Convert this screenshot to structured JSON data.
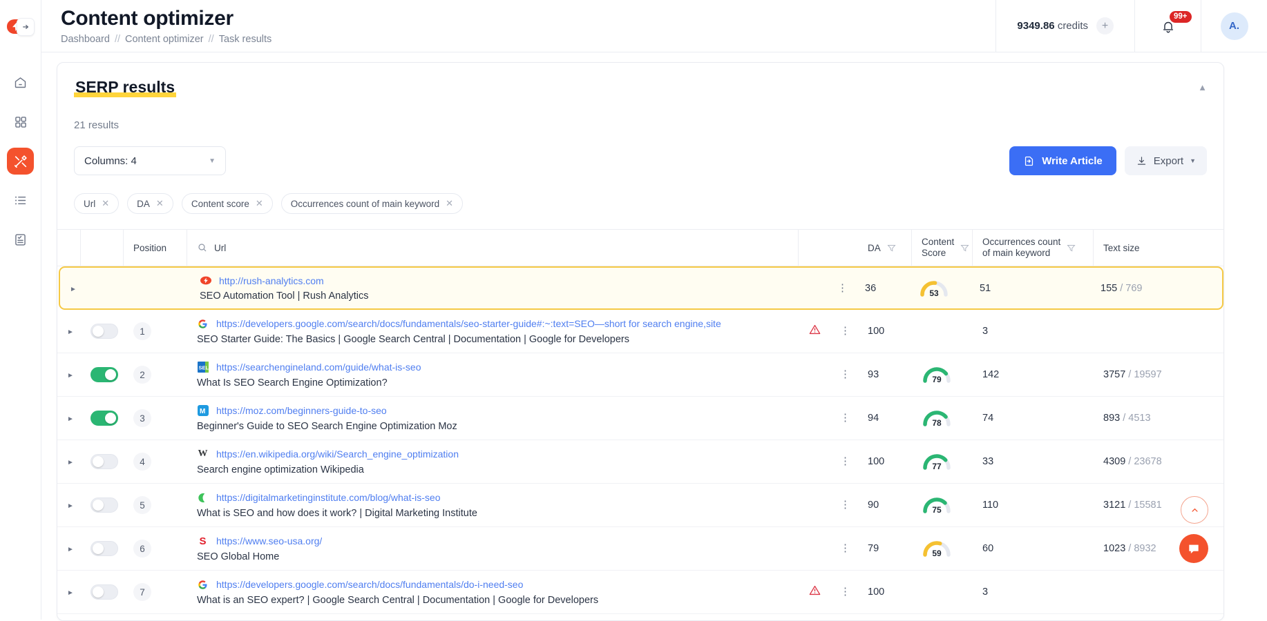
{
  "header": {
    "title": "Content optimizer",
    "breadcrumb": [
      "Dashboard",
      "Content optimizer",
      "Task results"
    ],
    "separator": "//",
    "credits_value": "9349.86",
    "credits_label": "credits",
    "add_credits_icon": "plus-icon",
    "notifications_badge": "99+",
    "notifications_icon": "bell-icon",
    "avatar_initials": "A.",
    "logo_icon": "lightning-bolt-logo",
    "sidebar_collapse_icon": "arrow-right-icon"
  },
  "sidebar": {
    "items": [
      {
        "name": "home",
        "icon": "home-icon",
        "active": false
      },
      {
        "name": "dashboard",
        "icon": "grid-icon",
        "active": false
      },
      {
        "name": "tools",
        "icon": "tools-icon",
        "active": true
      },
      {
        "name": "lists",
        "icon": "list-icon",
        "active": false
      },
      {
        "name": "reports",
        "icon": "document-check-icon",
        "active": false
      }
    ],
    "active_color": "#f4522d"
  },
  "card": {
    "title": "SERP results",
    "title_highlight_color": "#ffd43b",
    "collapse_icon": "chevron-up-icon",
    "results_count": "21 results",
    "columns_select": {
      "label": "Columns: 4",
      "caret_icon": "chevron-down-icon"
    },
    "buttons": {
      "write_article": {
        "label": "Write Article",
        "icon": "file-export-icon",
        "color": "#3b6ef5"
      },
      "export": {
        "label": "Export",
        "icon": "download-icon",
        "caret_icon": "caret-down-icon"
      }
    },
    "chips": [
      {
        "label": "Url",
        "remove_icon": "close-icon"
      },
      {
        "label": "DA",
        "remove_icon": "close-icon"
      },
      {
        "label": "Content score",
        "remove_icon": "close-icon"
      },
      {
        "label": "Occurrences count of main keyword",
        "remove_icon": "close-icon"
      }
    ]
  },
  "table": {
    "headers": {
      "position": "Position",
      "url": "Url",
      "url_search_icon": "search-icon",
      "da": "DA",
      "content_score_line1": "Content",
      "content_score_line2": "Score",
      "occurrences_line1": "Occurrences count",
      "occurrences_line2": "of main keyword",
      "text_size": "Text size",
      "filter_icon": "filter-icon"
    },
    "rows": [
      {
        "highlighted": true,
        "expand_icon": "caret-right-icon",
        "has_toggle": false,
        "position": "",
        "favicon": "rush-analytics-favicon",
        "favicon_char": "◆",
        "favicon_bg": "#f0452a",
        "url": "http://rush-analytics.com",
        "title": "SEO Automation Tool | Rush Analytics",
        "warning": false,
        "menu_icon": "kebab-menu-icon",
        "da": "36",
        "score": "53",
        "score_color": "#f5c131",
        "occurrences": "51",
        "text_size": "155",
        "text_total": "769"
      },
      {
        "highlighted": false,
        "expand_icon": "caret-right-icon",
        "has_toggle": true,
        "toggle_on": false,
        "position": "1",
        "favicon": "google-favicon",
        "favicon_char": "G",
        "favicon_color": "#4285f4",
        "url": "https://developers.google.com/search/docs/fundamentals/seo-starter-guide#:~:text=SEO—short for search engine,site",
        "title": "SEO Starter Guide: The Basics | Google Search Central | Documentation | Google for Developers",
        "warning": true,
        "warning_icon": "warning-triangle-icon",
        "menu_icon": "kebab-menu-icon",
        "da": "100",
        "score": "",
        "occurrences": "3",
        "text_size": "",
        "text_total": ""
      },
      {
        "highlighted": false,
        "expand_icon": "caret-right-icon",
        "has_toggle": true,
        "toggle_on": true,
        "position": "2",
        "favicon": "searchengineland-favicon",
        "favicon_char": "SEL",
        "favicon_bg": "#1a73c8",
        "url": "https://searchengineland.com/guide/what-is-seo",
        "title": "What Is SEO Search Engine Optimization?",
        "warning": false,
        "menu_icon": "kebab-menu-icon",
        "da": "93",
        "score": "79",
        "score_color": "#2bb673",
        "occurrences": "142",
        "text_size": "3757",
        "text_total": "19597"
      },
      {
        "highlighted": false,
        "expand_icon": "caret-right-icon",
        "has_toggle": true,
        "toggle_on": true,
        "position": "3",
        "favicon": "moz-favicon",
        "favicon_char": "M",
        "favicon_bg": "#1e9ae0",
        "url": "https://moz.com/beginners-guide-to-seo",
        "title": "Beginner's Guide to SEO Search Engine Optimization Moz",
        "warning": false,
        "menu_icon": "kebab-menu-icon",
        "da": "94",
        "score": "78",
        "score_color": "#2bb673",
        "occurrences": "74",
        "text_size": "893",
        "text_total": "4513"
      },
      {
        "highlighted": false,
        "expand_icon": "caret-right-icon",
        "has_toggle": true,
        "toggle_on": false,
        "position": "4",
        "favicon": "wikipedia-favicon",
        "favicon_char": "W",
        "favicon_color": "#36393b",
        "url": "https://en.wikipedia.org/wiki/Search_engine_optimization",
        "title": "Search engine optimization Wikipedia",
        "warning": false,
        "menu_icon": "kebab-menu-icon",
        "da": "100",
        "score": "77",
        "score_color": "#2bb673",
        "occurrences": "33",
        "text_size": "4309",
        "text_total": "23678"
      },
      {
        "highlighted": false,
        "expand_icon": "caret-right-icon",
        "has_toggle": true,
        "toggle_on": false,
        "position": "5",
        "favicon": "digitalmarketinginstitute-favicon",
        "favicon_char": "☾",
        "favicon_color": "#3ec35a",
        "url": "https://digitalmarketinginstitute.com/blog/what-is-seo",
        "title": "What is SEO and how does it work? | Digital Marketing Institute",
        "warning": false,
        "menu_icon": "kebab-menu-icon",
        "da": "90",
        "score": "75",
        "score_color": "#2bb673",
        "occurrences": "110",
        "text_size": "3121",
        "text_total": "15581"
      },
      {
        "highlighted": false,
        "expand_icon": "caret-right-icon",
        "has_toggle": true,
        "toggle_on": false,
        "position": "6",
        "favicon": "seo-usa-favicon",
        "favicon_char": "S",
        "favicon_color": "#e1202c",
        "url": "https://www.seo-usa.org/",
        "title": "SEO Global Home",
        "warning": false,
        "menu_icon": "kebab-menu-icon",
        "da": "79",
        "score": "59",
        "score_color": "#f5c131",
        "occurrences": "60",
        "text_size": "1023",
        "text_total": "8932"
      },
      {
        "highlighted": false,
        "expand_icon": "caret-right-icon",
        "has_toggle": true,
        "toggle_on": false,
        "position": "7",
        "favicon": "google-favicon",
        "favicon_char": "G",
        "favicon_color": "#4285f4",
        "url": "https://developers.google.com/search/docs/fundamentals/do-i-need-seo",
        "title": "What is an SEO expert? | Google Search Central | Documentation | Google for Developers",
        "warning": true,
        "warning_icon": "warning-triangle-icon",
        "menu_icon": "kebab-menu-icon",
        "da": "100",
        "score": "",
        "occurrences": "3",
        "text_size": "",
        "text_total": ""
      }
    ]
  },
  "floating": {
    "scroll_top_icon": "chevron-up-icon",
    "chat_icon": "chat-bubble-icon"
  }
}
